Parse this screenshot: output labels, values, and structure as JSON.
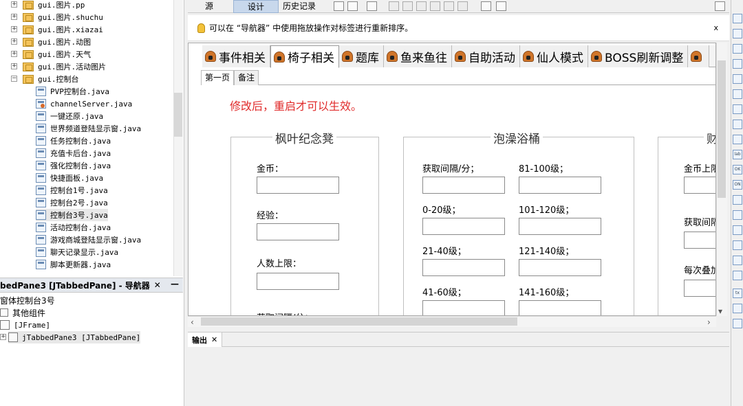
{
  "tree": {
    "items": [
      {
        "label": "gui.图片.pp",
        "type": "folder"
      },
      {
        "label": "gui.图片.shuchu",
        "type": "folder"
      },
      {
        "label": "gui.图片.xiazai",
        "type": "folder"
      },
      {
        "label": "gui.图片.动图",
        "type": "folder"
      },
      {
        "label": "gui.图片.天气",
        "type": "folder"
      },
      {
        "label": "gui.图片.活动图片",
        "type": "folder"
      },
      {
        "label": "gui.控制台",
        "type": "folder-open"
      },
      {
        "label": "PVP控制台.java",
        "type": "java"
      },
      {
        "label": "channelServer.java",
        "type": "java-special"
      },
      {
        "label": "一键还原.java",
        "type": "java"
      },
      {
        "label": "世界频道登陆显示窗.java",
        "type": "java"
      },
      {
        "label": "任务控制台.java",
        "type": "java"
      },
      {
        "label": "充值卡后台.java",
        "type": "java"
      },
      {
        "label": "强化控制台.java",
        "type": "java"
      },
      {
        "label": "快捷面板.java",
        "type": "java"
      },
      {
        "label": "控制台1号.java",
        "type": "java"
      },
      {
        "label": "控制台2号.java",
        "type": "java"
      },
      {
        "label": "控制台3号.java",
        "type": "java",
        "selected": true
      },
      {
        "label": "活动控制台.java",
        "type": "java"
      },
      {
        "label": "游戏商城登陆显示窗.java",
        "type": "java"
      },
      {
        "label": "聊天记录显示.java",
        "type": "java"
      },
      {
        "label": "脚本更新器.java",
        "type": "java"
      }
    ]
  },
  "navigator": {
    "title": "bedPane3 [JTabbedPane] - 导航器",
    "close": "✕",
    "minimize": "—",
    "items": [
      {
        "label": "窗体控制台3号"
      },
      {
        "label": "其他组件"
      },
      {
        "label": "[JFrame]"
      },
      {
        "label": "jTabbedPane3 [JTabbedPane]"
      }
    ]
  },
  "toolbar": {
    "source": "源",
    "design": "设计",
    "history": "历史记录"
  },
  "info": {
    "text": "可以在 “导航器” 中使用拖放操作对标签进行重新排序。",
    "close": "x"
  },
  "tabs": [
    {
      "label": "事件相关",
      "active": false
    },
    {
      "label": "椅子相关",
      "active": true
    },
    {
      "label": "题库",
      "active": false
    },
    {
      "label": "鱼来鱼往",
      "active": false
    },
    {
      "label": "自助活动",
      "active": false
    },
    {
      "label": "仙人模式",
      "active": false
    },
    {
      "label": "BOSS刷新调整",
      "active": false
    }
  ],
  "subtabs": [
    {
      "label": "第一页",
      "active": true
    },
    {
      "label": "备注",
      "active": false
    }
  ],
  "notice": "修改后，重启才可以生效。",
  "groups": {
    "g1": {
      "title": "枫叶纪念凳",
      "gold": "金币：",
      "exp": "经验：",
      "limit": "人数上限：",
      "interval": "获取间隔/分："
    },
    "g2": {
      "title": "泡澡浴桶",
      "interval": "获取间隔/分；",
      "l0_20": "0-20级；",
      "l21_40": "21-40级；",
      "l41_60": "41-60级；",
      "l81_100": "81-100级；",
      "l101_120": "101-120级；",
      "l121_140": "121-140级；",
      "l141_160": "141-160级；"
    },
    "g3": {
      "title": "财",
      "gold_limit": "金币上限",
      "interval": "获取间隔",
      "stack": "每次叠加"
    }
  },
  "output": {
    "tab": "输出",
    "close": "✕"
  },
  "colors": {
    "notice": "#e02a2a",
    "active_toolbar": "#c8d8ec"
  }
}
